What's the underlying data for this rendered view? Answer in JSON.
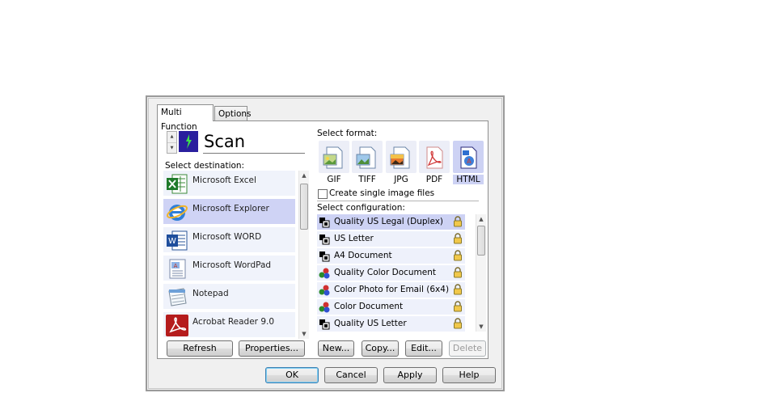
{
  "tabs": [
    "Multi Function",
    "Options"
  ],
  "scan": {
    "spinner_up": "▲",
    "spinner_down": "▼",
    "title": "Scan"
  },
  "destination": {
    "label": "Select destination:",
    "items": [
      {
        "name": "Microsoft Excel",
        "icon": "excel-icon"
      },
      {
        "name": "Microsoft Explorer",
        "icon": "internet-explorer-icon"
      },
      {
        "name": "Microsoft WORD",
        "icon": "word-icon"
      },
      {
        "name": "Microsoft WordPad",
        "icon": "wordpad-icon"
      },
      {
        "name": "Notepad",
        "icon": "notepad-icon"
      },
      {
        "name": "Acrobat Reader 9.0",
        "icon": "acrobat-icon"
      }
    ],
    "selected_index": 1
  },
  "format": {
    "label": "Select format:",
    "items": [
      "GIF",
      "TIFF",
      "JPG",
      "PDF",
      "HTML"
    ],
    "selected": "HTML",
    "checkbox_label": "Create single image files",
    "checkbox_checked": false
  },
  "configuration": {
    "label": "Select configuration:",
    "items": [
      {
        "name": "Quality US Legal (Duplex)",
        "icon": "bw-scan-icon"
      },
      {
        "name": "US Letter",
        "icon": "bw-scan-icon"
      },
      {
        "name": "A4 Document",
        "icon": "bw-scan-icon"
      },
      {
        "name": "Quality Color Document",
        "icon": "color-scan-icon"
      },
      {
        "name": "Color Photo for Email (6x4)",
        "icon": "color-scan-icon"
      },
      {
        "name": "Color Document",
        "icon": "color-scan-icon"
      },
      {
        "name": "Quality US Letter",
        "icon": "bw-scan-icon"
      }
    ],
    "selected_index": 0
  },
  "buttons": {
    "refresh": "Refresh",
    "properties": "Properties...",
    "new": "New...",
    "copy": "Copy...",
    "edit": "Edit...",
    "delete": "Delete",
    "ok": "OK",
    "cancel": "Cancel",
    "apply": "Apply",
    "help": "Help"
  },
  "colors": {
    "selection": "#cfd3f5",
    "item_bg": "#f0f3fb",
    "panel_bg": "#f0f0f0"
  }
}
